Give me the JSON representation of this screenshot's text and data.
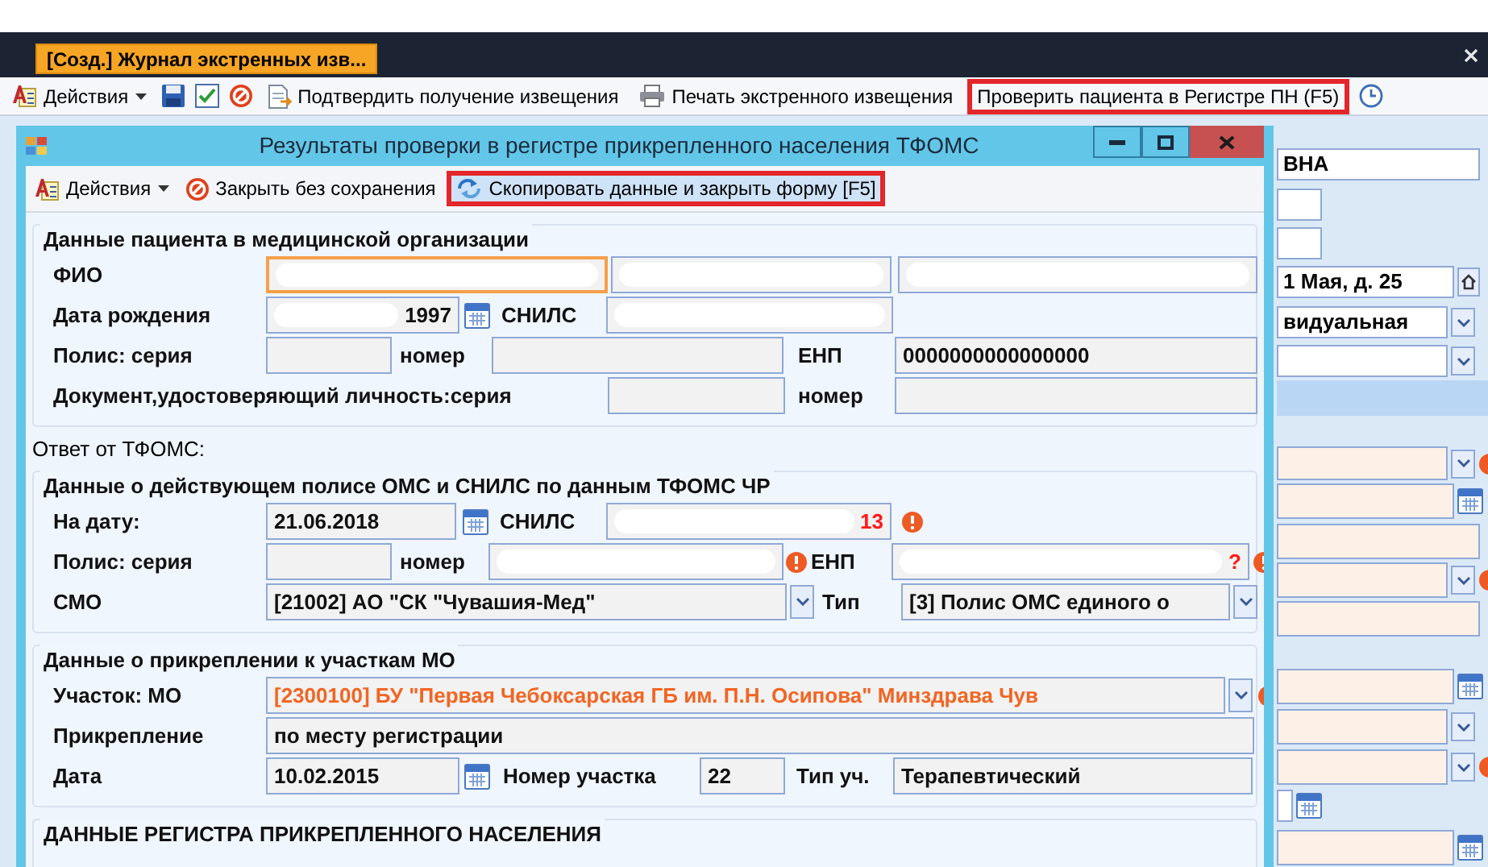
{
  "main_window": {
    "tab": {
      "label": "[Созд.] Журнал экстренных изв...",
      "selected": true
    },
    "toolbar": [
      {
        "kind": "actions",
        "label": "Действия"
      },
      {
        "kind": "save"
      },
      {
        "kind": "approve"
      },
      {
        "kind": "cancel"
      },
      {
        "kind": "confirm",
        "label": "Подтвердить получение извещения"
      },
      {
        "kind": "print",
        "label": "Печать экстренного извещения"
      },
      {
        "kind": "check_register",
        "label": "Проверить пациента в Регистре ПН (F5)",
        "highlighted": true
      },
      {
        "kind": "history"
      }
    ],
    "form_fields": [
      {
        "kind": "text",
        "value": "ВНА"
      },
      {
        "kind": "text"
      },
      {
        "kind": "text"
      },
      {
        "kind": "address",
        "value": "1 Мая, д. 25"
      },
      {
        "kind": "combo",
        "value": "видуальная"
      },
      {
        "kind": "combo"
      },
      {
        "kind": "band"
      },
      {
        "kind": "combo",
        "required": true,
        "alert": true
      },
      {
        "kind": "date",
        "required": true
      },
      {
        "kind": "text",
        "required": true
      },
      {
        "kind": "combo",
        "required": true,
        "alert": true
      },
      {
        "kind": "text",
        "required": true
      },
      {
        "kind": "date",
        "required": true
      },
      {
        "kind": "combo",
        "required": true
      },
      {
        "kind": "combo",
        "required": true,
        "alert": true
      },
      {
        "kind": "date"
      },
      {
        "kind": "date",
        "required": true
      }
    ]
  },
  "dialog": {
    "title": "Результаты проверки в регистре прикрепленного населения ТФОМС",
    "toolbar": [
      {
        "kind": "actions",
        "label": "Действия"
      },
      {
        "kind": "close",
        "label": "Закрыть без сохранения"
      },
      {
        "kind": "copy",
        "label": "Скопировать данные и закрыть форму [F5]",
        "highlighted": true
      }
    ],
    "sections": [
      {
        "kind": "group",
        "title": "Данные пациента в медицинской организации",
        "rows": [
          {
            "label": "ФИО",
            "items": [
              {
                "kind": "field",
                "redacted": true,
                "focused": true
              },
              {
                "kind": "field",
                "redacted": true
              },
              {
                "kind": "field",
                "redacted": true
              }
            ]
          },
          {
            "label": "Дата рождения",
            "items": [
              {
                "kind": "field",
                "value": "1997",
                "redacted": true
              },
              {
                "kind": "date_button"
              },
              {
                "kind": "label",
                "text": "СНИЛС"
              },
              {
                "kind": "field",
                "redacted": true
              }
            ]
          },
          {
            "label": "Полис: серия",
            "items": [
              {
                "kind": "field"
              },
              {
                "kind": "label",
                "text": "номер"
              },
              {
                "kind": "field"
              },
              {
                "kind": "label",
                "text": "ЕНП"
              },
              {
                "kind": "field",
                "value": "0000000000000000"
              }
            ]
          },
          {
            "label": "Документ,удостоверяющий личность:серия",
            "items": [
              {
                "kind": "field"
              },
              {
                "kind": "label",
                "text": "номер"
              },
              {
                "kind": "field"
              }
            ]
          }
        ]
      },
      {
        "kind": "note",
        "title": "Ответ от ТФОМС:"
      },
      {
        "kind": "group",
        "title": "Данные о действующем полисе ОМС и СНИЛС по данным ТФОМС ЧР",
        "rows": [
          {
            "label": "На дату:",
            "items": [
              {
                "kind": "field",
                "value": "21.06.2018"
              },
              {
                "kind": "date_button"
              },
              {
                "kind": "label",
                "text": "СНИЛС"
              },
              {
                "kind": "field",
                "value": "13",
                "redacted": true,
                "error": true
              },
              {
                "kind": "alert"
              }
            ]
          },
          {
            "label": "Полис: серия",
            "items": [
              {
                "kind": "field"
              },
              {
                "kind": "label",
                "text": "номер"
              },
              {
                "kind": "field",
                "redacted": true,
                "error": true
              },
              {
                "kind": "alert"
              },
              {
                "kind": "label",
                "text": "ЕНП"
              },
              {
                "kind": "field",
                "value": "?",
                "redacted": true,
                "error": true
              },
              {
                "kind": "alert"
              }
            ]
          },
          {
            "label": "СМО",
            "items": [
              {
                "kind": "combo",
                "value": "[21002] АО \"СК \"Чувашия-Мед\""
              },
              {
                "kind": "label",
                "text": "Тип"
              },
              {
                "kind": "combo",
                "value": "[3] Полис ОМС единого о"
              }
            ]
          }
        ]
      },
      {
        "kind": "group",
        "title": "Данные о прикреплении к участкам МО",
        "rows": [
          {
            "label": "Участок: МО",
            "items": [
              {
                "kind": "combo",
                "value": "[2300100] БУ \"Первая Чебоксарская ГБ им. П.Н. Осипова\" Минздрава Чув",
                "warning": true
              },
              {
                "kind": "alert"
              }
            ]
          },
          {
            "label": "Прикрепление",
            "items": [
              {
                "kind": "field",
                "value": "по месту регистрации"
              }
            ]
          },
          {
            "label": "Дата",
            "items": [
              {
                "kind": "field",
                "value": "10.02.2015"
              },
              {
                "kind": "date_button"
              },
              {
                "kind": "label",
                "text": "Номер участка"
              },
              {
                "kind": "field",
                "value": "22"
              },
              {
                "kind": "label",
                "text": "Тип уч."
              },
              {
                "kind": "field",
                "value": "Терапевтический"
              }
            ]
          }
        ]
      },
      {
        "kind": "group",
        "title": "ДАННЫЕ РЕГИСТРА ПРИКРЕПЛЕННОГО НАСЕЛЕНИЯ"
      }
    ]
  }
}
